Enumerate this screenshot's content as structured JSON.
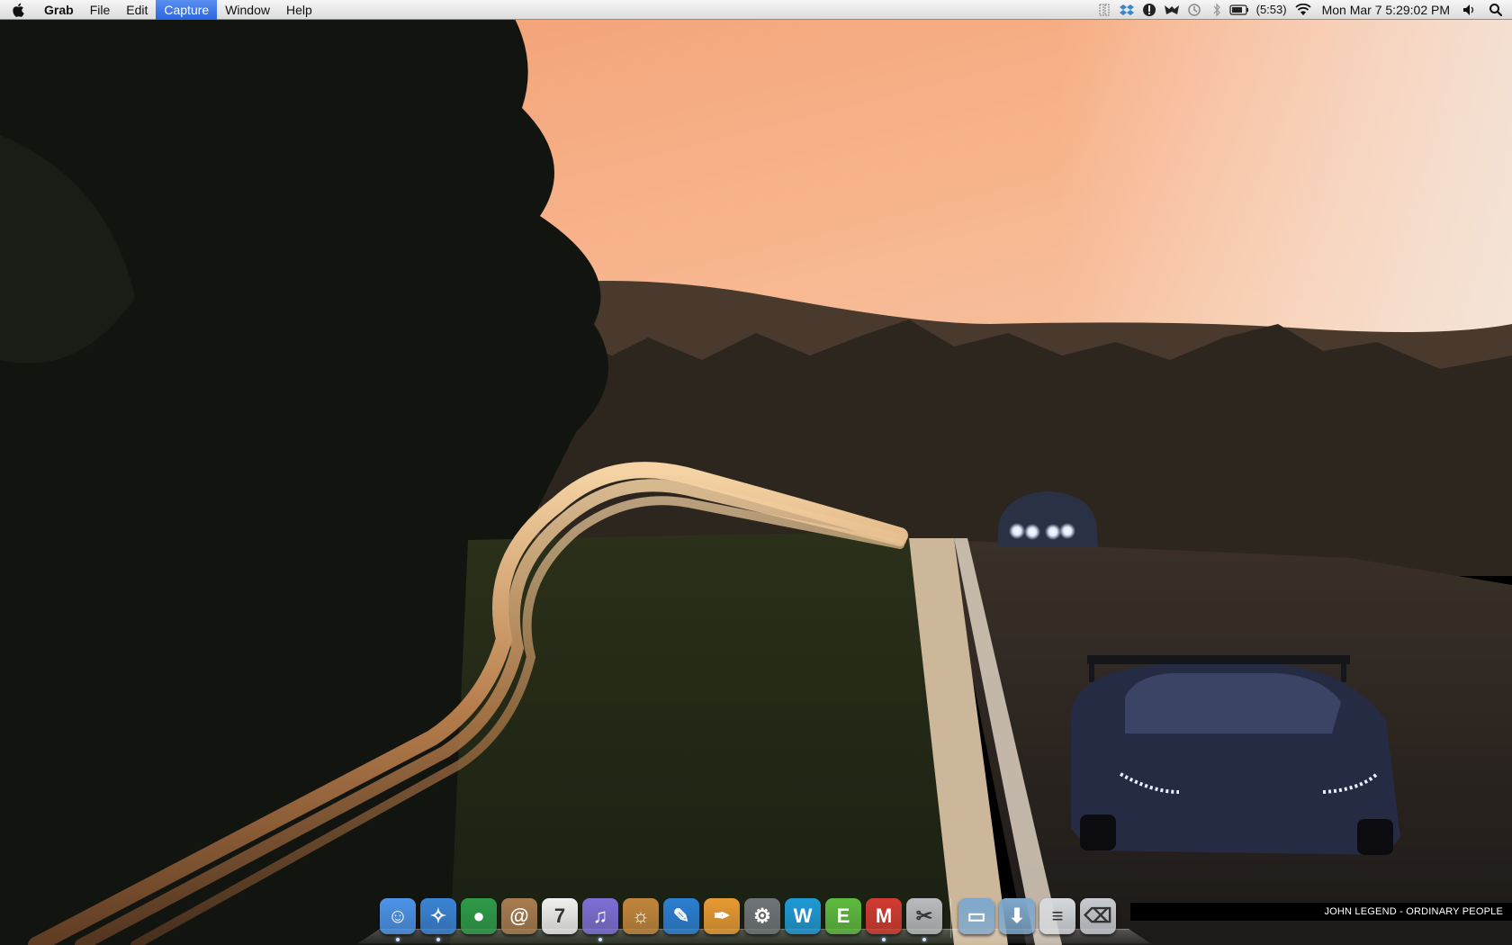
{
  "menubar": {
    "app_name": "Grab",
    "items": [
      "File",
      "Edit",
      "Capture",
      "Window",
      "Help"
    ],
    "active_item": "Capture",
    "status_icons": [
      "ichat-icon",
      "dropbox-icon",
      "alert-icon",
      "growl-icon",
      "time-machine-icon",
      "bluetooth-icon"
    ],
    "battery_time": "(5:53)",
    "clock": "Mon Mar 7  5:29:02 PM"
  },
  "dock": {
    "apps": [
      {
        "name": "finder-icon",
        "glyph": "☺",
        "color": "#4d94e8",
        "running": true
      },
      {
        "name": "safari-icon",
        "glyph": "✧",
        "color": "#3b84d6",
        "running": true
      },
      {
        "name": "chrome-icon",
        "glyph": "●",
        "color": "#2e9b49",
        "running": false
      },
      {
        "name": "address-book-icon",
        "glyph": "@",
        "color": "#a87c4f",
        "running": false
      },
      {
        "name": "ical-icon",
        "glyph": "7",
        "color": "#f1f1f1",
        "running": false
      },
      {
        "name": "itunes-icon",
        "glyph": "♫",
        "color": "#7d6fd6",
        "running": true
      },
      {
        "name": "iphoto-icon",
        "glyph": "☼",
        "color": "#c2863c",
        "running": false
      },
      {
        "name": "skitch-icon",
        "glyph": "✎",
        "color": "#2c7fd3",
        "running": false
      },
      {
        "name": "pages-icon",
        "glyph": "✒",
        "color": "#e89a33",
        "running": false
      },
      {
        "name": "system-preferences-icon",
        "glyph": "⚙",
        "color": "#6f7478",
        "running": false
      },
      {
        "name": "writer-icon",
        "glyph": "W",
        "color": "#1f9ad6",
        "running": false
      },
      {
        "name": "evernote-icon",
        "glyph": "E",
        "color": "#5fba3f",
        "running": false
      },
      {
        "name": "gmail-icon",
        "glyph": "M",
        "color": "#d23b32",
        "running": true
      },
      {
        "name": "grab-icon",
        "glyph": "✂",
        "color": "#b9bcbf",
        "running": true
      }
    ],
    "stacks": [
      {
        "name": "applications-stack-icon",
        "glyph": "▭",
        "color": "#7fa8cc"
      },
      {
        "name": "downloads-stack-icon",
        "glyph": "⬇",
        "color": "#7fa8cc"
      },
      {
        "name": "documents-stack-icon",
        "glyph": "≡",
        "color": "#d6d9dd"
      },
      {
        "name": "trash-icon",
        "glyph": "⌫",
        "color": "#c9ccd0"
      }
    ]
  },
  "now_playing": "JOHN LEGEND - ORDINARY PEOPLE"
}
